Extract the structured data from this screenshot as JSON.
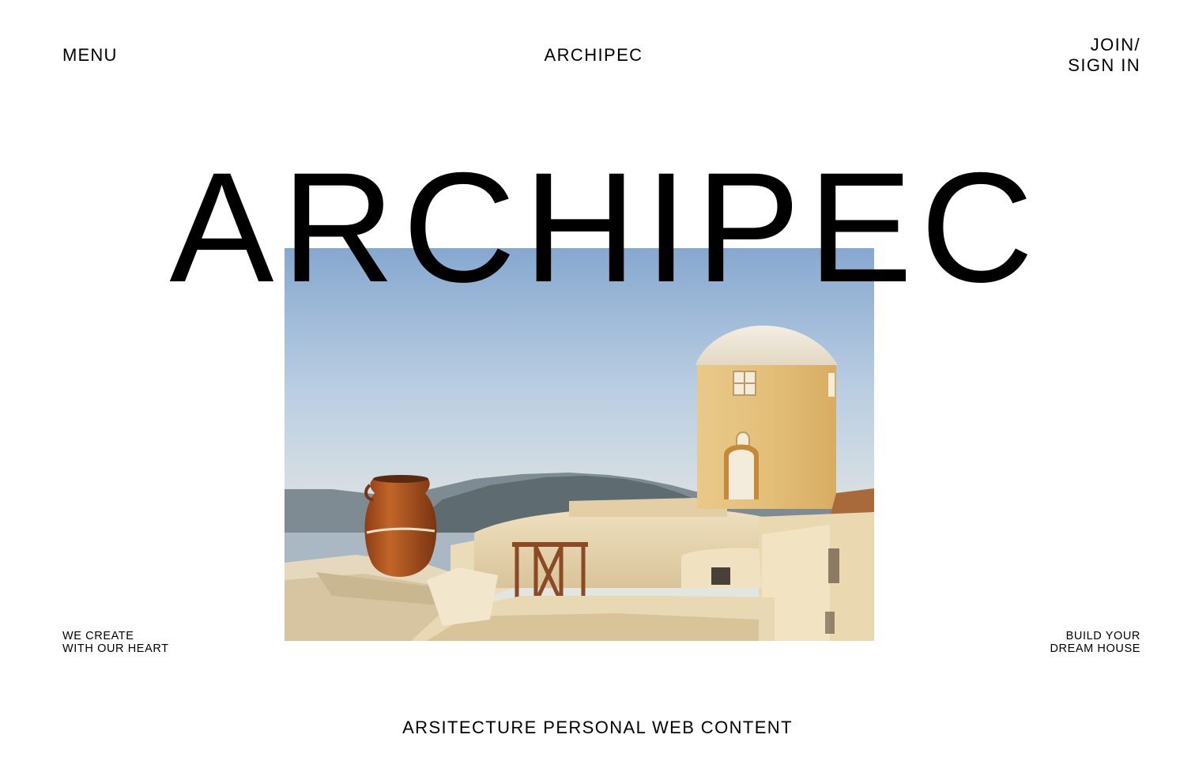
{
  "header": {
    "menu_label": "MENU",
    "brand": "ARCHIPEC",
    "auth_line1": "JOIN/",
    "auth_line2": "SIGN IN"
  },
  "hero": {
    "title": "ARCHIPEC",
    "image_alt": "Santorini rooftop with terracotta amphora and whitewashed domed tower overlooking the sea"
  },
  "taglines": {
    "left_line1": "WE CREATE",
    "left_line2": "WITH OUR HEART",
    "right_line1": "BUILD YOUR",
    "right_line2": "DREAM HOUSE"
  },
  "footer": {
    "subtitle": "ARSITECTURE PERSONAL WEB CONTENT"
  },
  "colors": {
    "background": "#ffffff",
    "text": "#000000",
    "sky_top": "#86a8cf",
    "sky_bottom": "#dfe4e2",
    "plaster": "#e9d6b0",
    "amphora": "#b4571f"
  }
}
